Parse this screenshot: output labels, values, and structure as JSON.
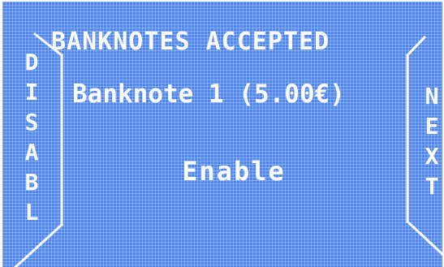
{
  "screen": {
    "title": "BANKNOTES ACCEPTED",
    "banknote_label": "Banknote 1 (5.00€)",
    "enable_label": "Enable",
    "disable_letters": [
      "D",
      "I",
      "S",
      "A",
      "B",
      "L"
    ],
    "next_letters": [
      "N",
      "E",
      "X",
      "T"
    ]
  },
  "colors": {
    "background": "#4f86ee",
    "foreground": "#ffffff"
  }
}
